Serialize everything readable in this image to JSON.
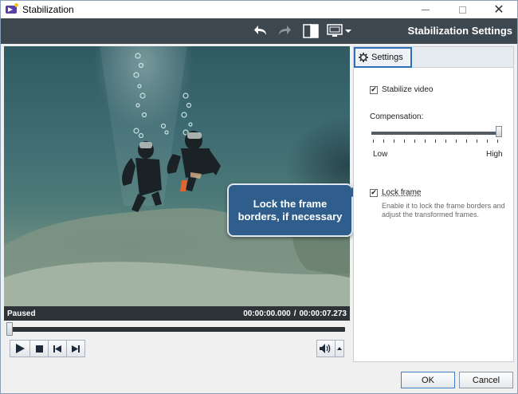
{
  "window": {
    "title": "Stabilization"
  },
  "toolbar": {
    "title": "Stabilization Settings",
    "icons": [
      "undo-icon",
      "redo-icon",
      "split-view-icon",
      "monitor-icon",
      "dropdown-arrow-icon"
    ]
  },
  "video": {
    "status": "Paused",
    "current_time": "00:00:00.000",
    "time_separator": "/",
    "total_time": "00:00:07.273",
    "progress": 0
  },
  "callout": {
    "text": "Lock the frame borders, if necessary"
  },
  "settings": {
    "tab_label": "Settings",
    "stabilize_label": "Stabilize video",
    "stabilize_checked": true,
    "compensation_label": "Compensation:",
    "compensation_value": 1.0,
    "low_label": "Low",
    "high_label": "High",
    "lock_frame_label": "Lock frame",
    "lock_frame_checked": true,
    "lock_frame_description": "Enable it to lock the frame borders and adjust the transformed frames."
  },
  "buttons": {
    "ok": "OK",
    "cancel": "Cancel"
  },
  "colors": {
    "toolbar_bg": "#3d4750",
    "callout_bg": "#2f5e8c",
    "tab_highlight": "#2f6fb8"
  }
}
